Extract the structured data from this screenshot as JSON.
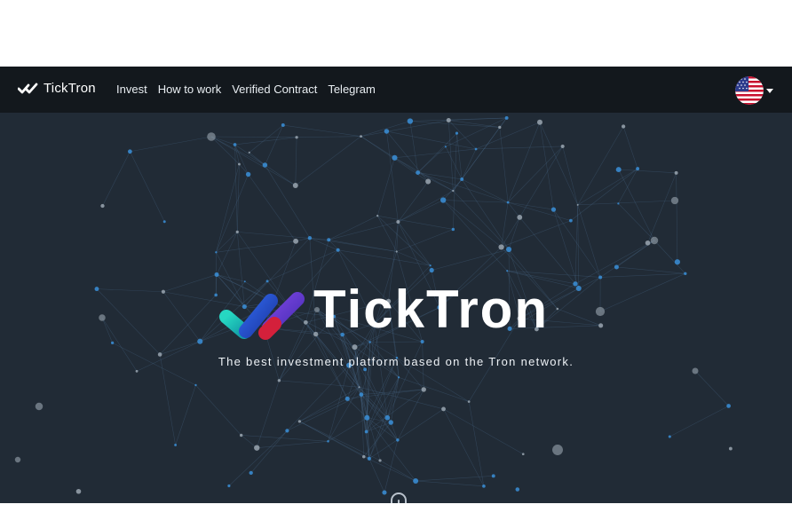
{
  "navbar": {
    "brand": "TickTron",
    "links": [
      "Invest",
      "How to work",
      "Verified Contract",
      "Telegram"
    ],
    "language_icon": "us-flag-icon"
  },
  "hero": {
    "title": "TickTron",
    "subtitle": "The best investment platform based on the Tron network.",
    "scroll_icon": "mouse-scroll-icon"
  },
  "colors": {
    "navbar_bg": "#13181d",
    "hero_bg": "#212b36",
    "accent_teal": "#1fc7b8",
    "accent_blue": "#2b4fd8",
    "accent_red": "#d4203b",
    "accent_purple": "#6a3ad0",
    "network_dots": "#3a8fd8"
  }
}
